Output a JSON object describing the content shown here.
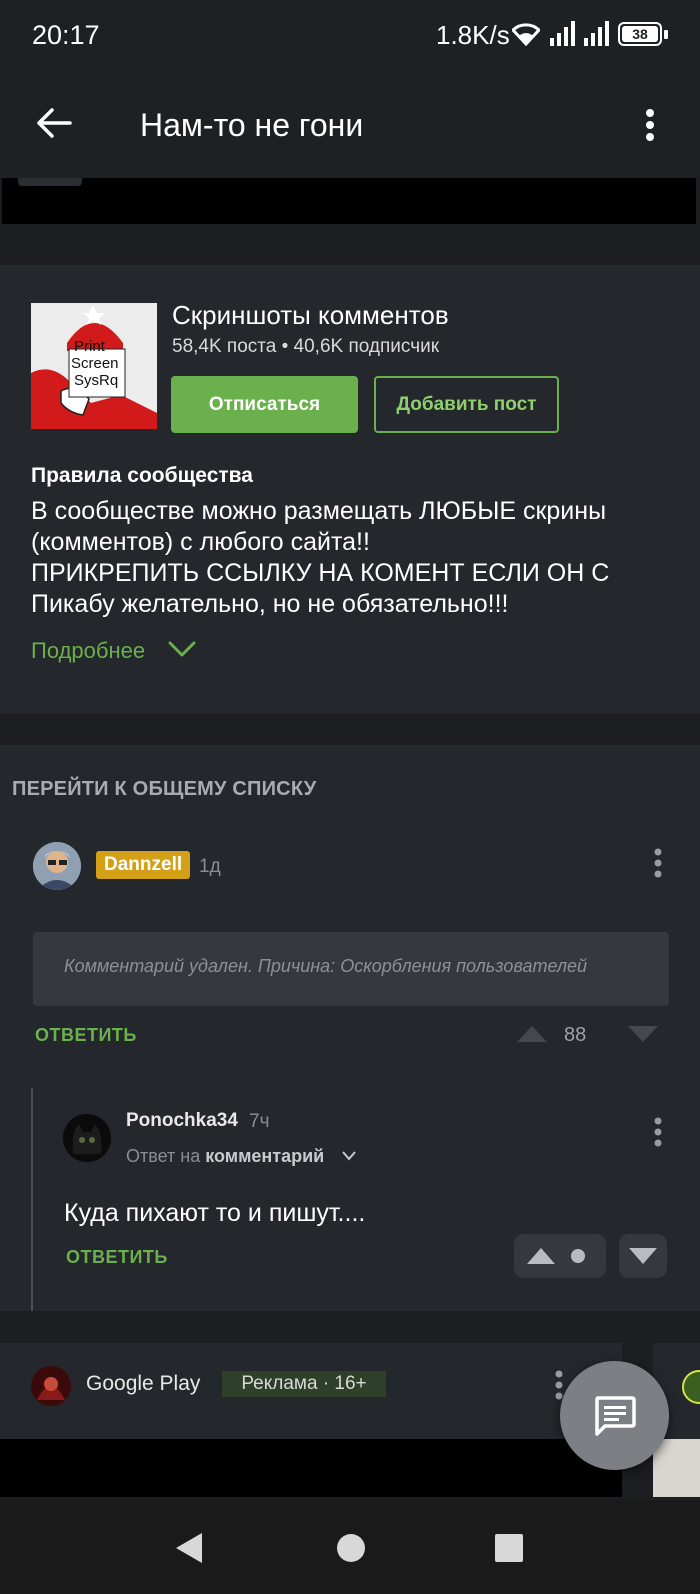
{
  "status_bar": {
    "time": "20:17",
    "net_speed": "1.8K/s",
    "battery": "38"
  },
  "app_bar": {
    "title": "Нам-то не гони"
  },
  "community": {
    "image_text": [
      "Print",
      "Screen",
      "SysRq"
    ],
    "name": "Скриншоты комментов",
    "stats": "58,4K поста • 40,6K подписчик",
    "unsubscribe_label": "Отписаться",
    "add_post_label": "Добавить пост",
    "rules_title": "Правила сообщества",
    "rules_text": "В сообществе можно размещать ЛЮБЫЕ скрины (комментов) с любого сайта!!\nПРИКРЕПИТЬ ССЫЛКУ НА КОМЕНТ ЕСЛИ ОН С Пикабу желательно, но не обязательно!!!",
    "more_label": "Подробнее"
  },
  "comments": {
    "goto_label": "ПЕРЕЙТИ К ОБЩЕМУ СПИСКУ",
    "first": {
      "author": "Dannzell",
      "time": "1д",
      "deleted_text": "Комментарий удален. Причина: Оскорбления пользователей",
      "reply_label": "ОТВЕТИТЬ",
      "score": "88"
    },
    "second": {
      "author": "Ponochka34",
      "time": "7ч",
      "reply_to_prefix": "Ответ на",
      "reply_to_target": "комментарий",
      "text": "Куда пихают то и пишут....",
      "reply_label": "ОТВЕТИТЬ"
    }
  },
  "ad": {
    "name": "Google Play",
    "badge": "Реклама · 16+"
  },
  "colors": {
    "accent": "#6ab04c",
    "background": "#1c1e21",
    "card": "#24272b",
    "user_badge": "#d4a017"
  }
}
